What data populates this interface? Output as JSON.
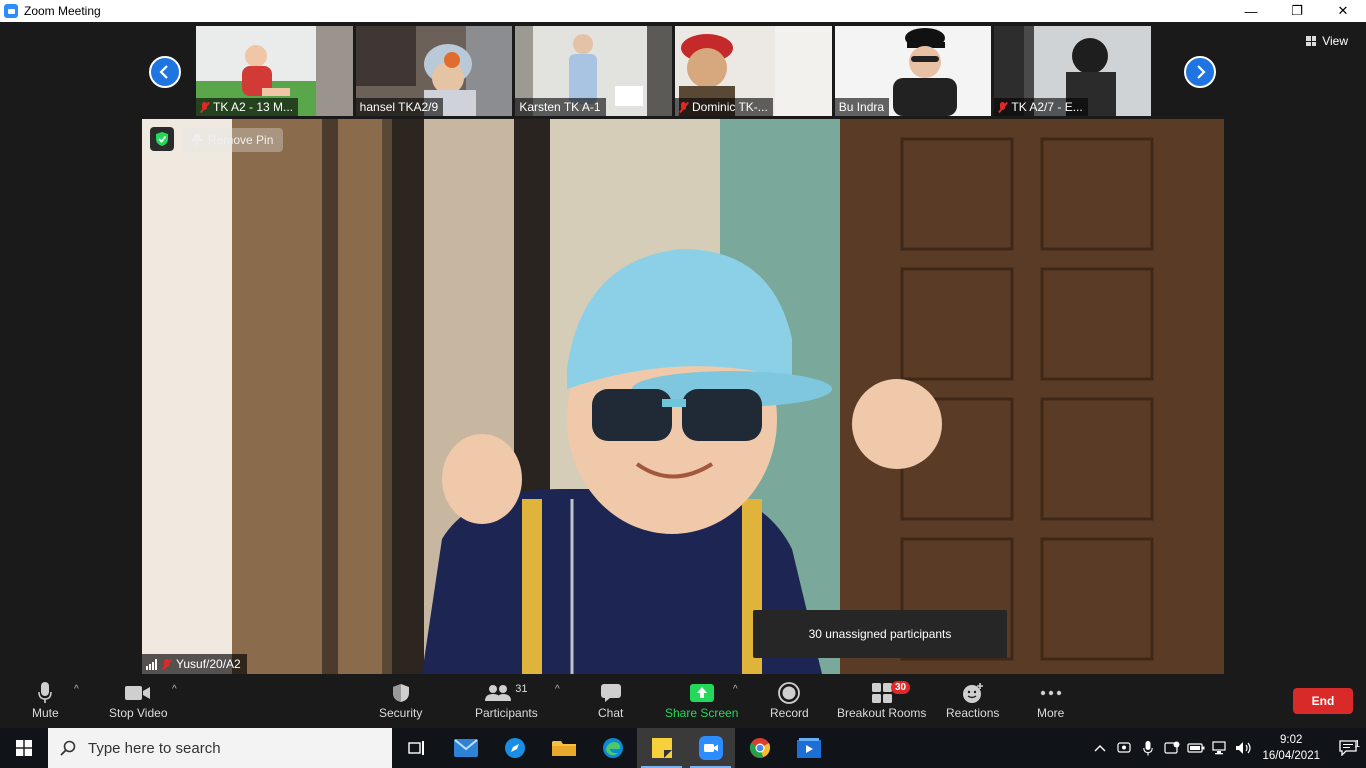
{
  "window": {
    "title": "Zoom Meeting",
    "minimize": "—",
    "restore": "❐",
    "close": "✕"
  },
  "strip": {
    "view_label": "View",
    "thumbnails": [
      {
        "name": "TK A2 - 13 M...",
        "muted": true
      },
      {
        "name": "hansel TKA2/9",
        "muted": false
      },
      {
        "name": "Karsten TK A-1",
        "muted": false
      },
      {
        "name": "Dominic TK-...",
        "muted": true
      },
      {
        "name": "Bu Indra",
        "muted": false
      },
      {
        "name": "TK A2/7  -  E...",
        "muted": true
      }
    ]
  },
  "main_video": {
    "remove_pin_label": "Remove Pin",
    "participant_name": "Yusuf/20/A2",
    "muted": true,
    "breakout_tooltip": "30 unassigned participants"
  },
  "toolbar": {
    "mute_label": "Mute",
    "stop_video_label": "Stop Video",
    "security_label": "Security",
    "participants_label": "Participants",
    "participants_count": "31",
    "chat_label": "Chat",
    "share_screen_label": "Share Screen",
    "record_label": "Record",
    "breakout_rooms_label": "Breakout Rooms",
    "breakout_count": "30",
    "reactions_label": "Reactions",
    "more_label": "More",
    "end_label": "End"
  },
  "taskbar": {
    "search_placeholder": "Type here to search",
    "time": "9:02",
    "date": "16/04/2021",
    "notification_count": "1"
  },
  "colors": {
    "zoom_blue": "#2d8cff",
    "end_red": "#d92a2a",
    "share_green": "#23d959",
    "mute_red": "#e02828"
  }
}
